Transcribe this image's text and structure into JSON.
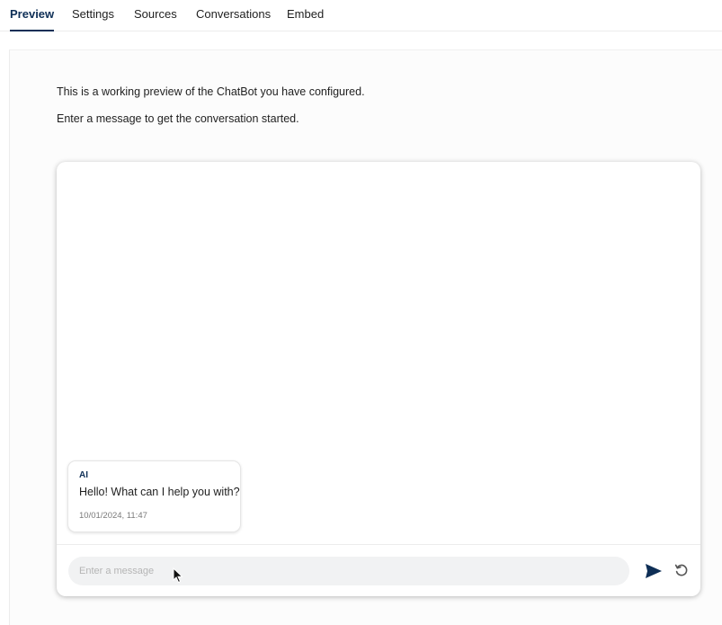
{
  "tabs": [
    {
      "label": "Preview",
      "active": true
    },
    {
      "label": "Settings",
      "active": false
    },
    {
      "label": "Sources",
      "active": false
    },
    {
      "label": "Conversations",
      "active": false
    },
    {
      "label": "Embed",
      "active": false
    }
  ],
  "intro": {
    "line1": "This is a working preview of the ChatBot you have configured.",
    "line2": "Enter a message to get the conversation started."
  },
  "chat": {
    "messages": [
      {
        "sender": "AI",
        "text": "Hello! What can I help you with?",
        "timestamp": "10/01/2024, 11:47"
      }
    ],
    "input": {
      "placeholder": "Enter a message",
      "value": ""
    },
    "icons": {
      "send": "send-icon",
      "reset": "refresh-icon"
    }
  },
  "colors": {
    "accent": "#0e2f56",
    "input_bg": "#f1f2f3",
    "timestamp": "#7a7a7a"
  }
}
